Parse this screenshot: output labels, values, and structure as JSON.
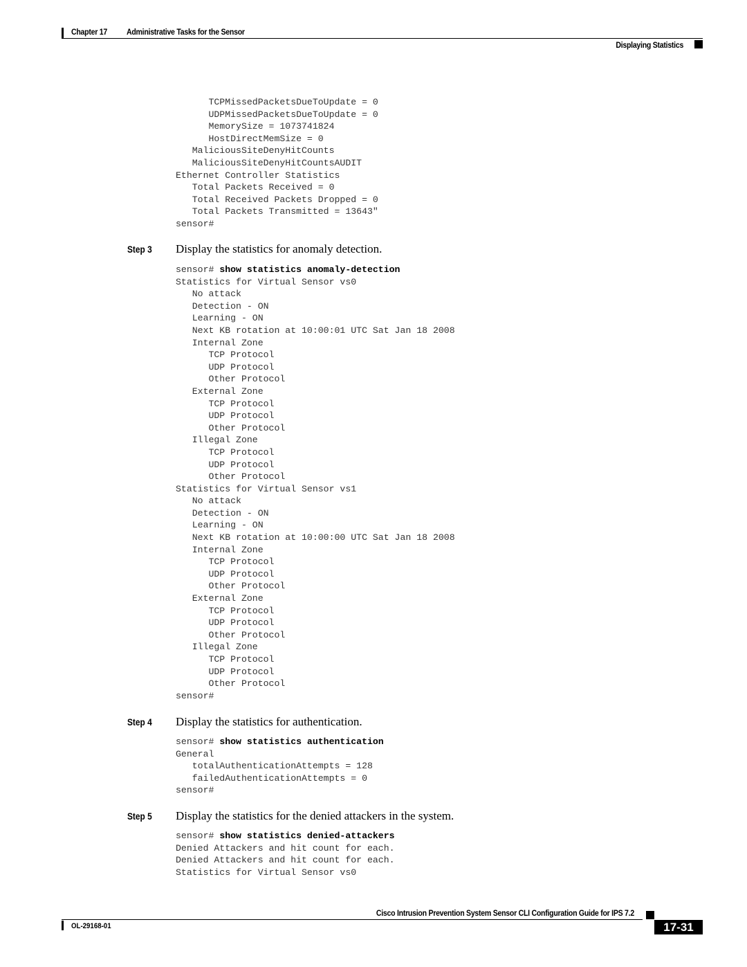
{
  "header": {
    "chapter": "Chapter 17",
    "chapter_title": "Administrative Tasks for the Sensor",
    "section": "Displaying Statistics"
  },
  "code_top": {
    "lines": [
      "      TCPMissedPacketsDueToUpdate = 0",
      "      UDPMissedPacketsDueToUpdate = 0",
      "      MemorySize = 1073741824",
      "      HostDirectMemSize = 0",
      "   MaliciousSiteDenyHitCounts",
      "   MaliciousSiteDenyHitCountsAUDIT",
      "Ethernet Controller Statistics",
      "   Total Packets Received = 0",
      "   Total Received Packets Dropped = 0",
      "   Total Packets Transmitted = 13643\"",
      "sensor#"
    ]
  },
  "steps": [
    {
      "label": "Step 3",
      "text": "Display the statistics for anomaly detection.",
      "prompt": "sensor# ",
      "command": "show statistics anomaly-detection",
      "output": [
        "Statistics for Virtual Sensor vs0",
        "   No attack",
        "   Detection - ON",
        "   Learning - ON",
        "   Next KB rotation at 10:00:01 UTC Sat Jan 18 2008",
        "   Internal Zone",
        "      TCP Protocol",
        "      UDP Protocol",
        "      Other Protocol",
        "   External Zone",
        "      TCP Protocol",
        "      UDP Protocol",
        "      Other Protocol",
        "   Illegal Zone",
        "      TCP Protocol",
        "      UDP Protocol",
        "      Other Protocol",
        "Statistics for Virtual Sensor vs1",
        "   No attack",
        "   Detection - ON",
        "   Learning - ON",
        "   Next KB rotation at 10:00:00 UTC Sat Jan 18 2008",
        "   Internal Zone",
        "      TCP Protocol",
        "      UDP Protocol",
        "      Other Protocol",
        "   External Zone",
        "      TCP Protocol",
        "      UDP Protocol",
        "      Other Protocol",
        "   Illegal Zone",
        "      TCP Protocol",
        "      UDP Protocol",
        "      Other Protocol",
        "sensor#"
      ]
    },
    {
      "label": "Step 4",
      "text": "Display the statistics for authentication.",
      "prompt": "sensor# ",
      "command": "show statistics authentication",
      "output": [
        "General",
        "   totalAuthenticationAttempts = 128",
        "   failedAuthenticationAttempts = 0",
        "sensor#"
      ]
    },
    {
      "label": "Step 5",
      "text": "Display the statistics for the denied attackers in the system.",
      "prompt": "sensor# ",
      "command": "show statistics denied-attackers",
      "output": [
        "Denied Attackers and hit count for each.",
        "Denied Attackers and hit count for each.",
        "Statistics for Virtual Sensor vs0"
      ]
    }
  ],
  "footer": {
    "guide_title": "Cisco Intrusion Prevention System Sensor CLI Configuration Guide for IPS 7.2",
    "doc_id": "OL-29168-01",
    "page_number": "17-31"
  }
}
